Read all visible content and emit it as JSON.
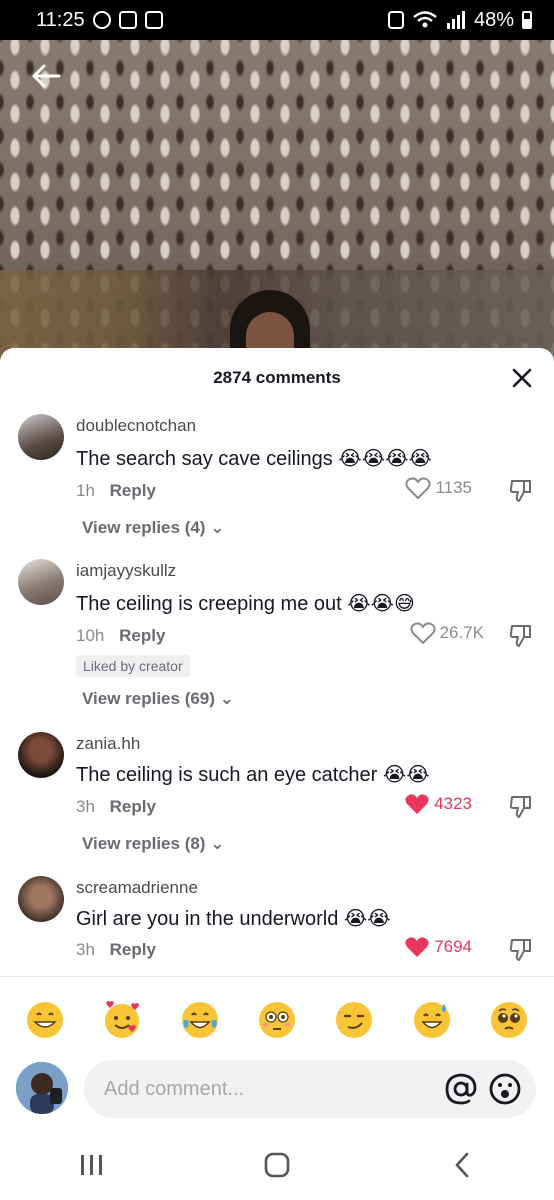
{
  "status_bar": {
    "time": "11:25",
    "battery": "48%"
  },
  "comments_sheet": {
    "title": "2874 comments",
    "comments": [
      {
        "username": "doublecnotchan",
        "text": "The search say cave ceilings",
        "emojis": "😭😭😭😭",
        "age": "1h",
        "reply_label": "Reply",
        "likes": "1135",
        "liked": false,
        "view_replies": "View replies (4)"
      },
      {
        "username": "iamjayyskullz",
        "text": "The ceiling is creeping me out",
        "emojis": "😭😭😅",
        "age": "10h",
        "reply_label": "Reply",
        "likes": "26.7K",
        "liked": false,
        "badge": "Liked by creator",
        "view_replies": "View replies (69)"
      },
      {
        "username": "zania.hh",
        "text": "The ceiling is such an eye catcher",
        "emojis": "😭😭",
        "age": "3h",
        "reply_label": "Reply",
        "likes": "4323",
        "liked": true,
        "view_replies": "View replies (8)"
      },
      {
        "username": "screamadrienne",
        "text": "Girl are you in the underworld",
        "emojis": "😭😭",
        "age": "3h",
        "reply_label": "Reply",
        "likes": "7694",
        "liked": true
      }
    ]
  },
  "quick_emojis": [
    "grin",
    "smiling-face-with-hearts",
    "tears-of-joy",
    "flushed",
    "smirk",
    "sweat-smile",
    "pleading"
  ],
  "composer": {
    "placeholder": "Add comment..."
  },
  "colors": {
    "like_red": "#e8365d",
    "text_primary": "#161823",
    "text_secondary": "#8a8b91"
  }
}
